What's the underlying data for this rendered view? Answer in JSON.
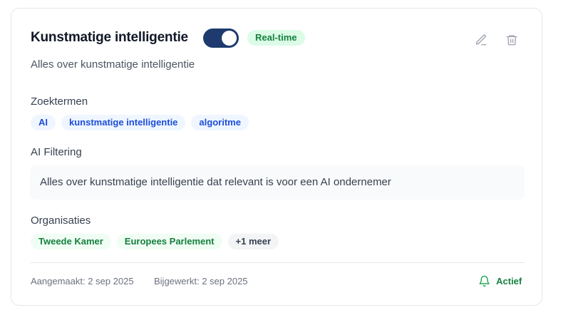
{
  "card": {
    "title": "Kunstmatige intelligentie",
    "realtime_badge": "Real-time",
    "toggle_on": true,
    "description": "Alles over kunstmatige intelligentie",
    "keywords_label": "Zoektermen",
    "keywords": [
      "AI",
      "kunstmatige intelligentie",
      "algoritme"
    ],
    "ai_filter_label": "AI Filtering",
    "ai_filter_text": "Alles over kunstmatige intelligentie dat relevant is voor een AI ondernemer",
    "orgs_label": "Organisaties",
    "orgs": [
      "Tweede Kamer",
      "Europees Parlement"
    ],
    "orgs_more": "+1 meer",
    "created": "Aangemaakt: 2 sep 2025",
    "updated": "Bijgewerkt: 2 sep 2025",
    "status": "Actief"
  },
  "icons": {
    "edit": "pencil-icon",
    "delete": "trash-icon",
    "status": "bell-icon"
  },
  "colors": {
    "toggle": "#1e3a6e",
    "green": "#15803d",
    "green_bg": "#dcfce7",
    "blue": "#1d4ed8",
    "blue_bg": "#eff6ff"
  }
}
